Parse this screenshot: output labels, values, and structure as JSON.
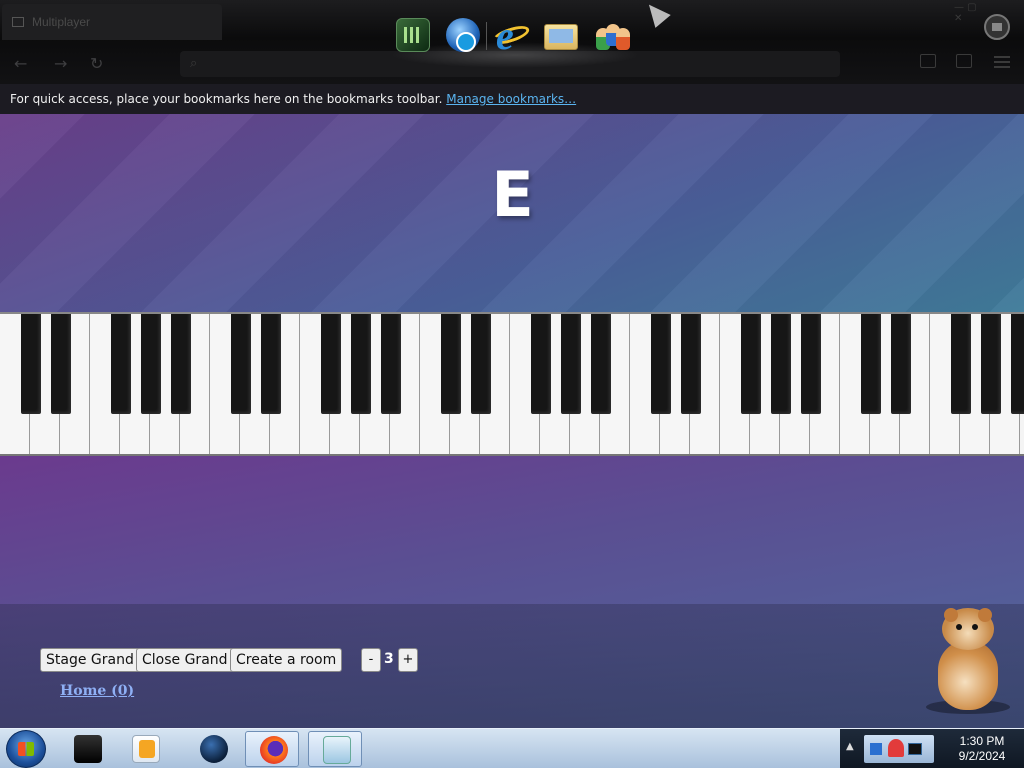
{
  "browser": {
    "tab_title": "Multiplayer"
  },
  "bookmarks_bar": {
    "message": "For quick access, place your bookmarks here on the bookmarks toolbar.",
    "manage_link": "Manage bookmarks…"
  },
  "piano_page": {
    "current_note": "E",
    "buttons": {
      "stage_grand": "Stage Grand",
      "close_grand": "Close Grand",
      "create_room": "Create a room"
    },
    "volume": {
      "minus": "-",
      "value": "3",
      "plus": "+"
    },
    "home_link": "Home (0)",
    "keyboard": {
      "white_key_count": 34,
      "black_key_pattern": [
        1,
        1,
        0,
        1,
        1,
        1,
        0
      ]
    }
  },
  "taskbar": {
    "items": [
      "media-center-icon",
      "media-player-icon",
      "globe-icon",
      "firefox-icon",
      "notes-icon"
    ],
    "active_item": "firefox-icon",
    "clock": {
      "time": "1:30 PM",
      "date": "9/2/2024"
    }
  }
}
